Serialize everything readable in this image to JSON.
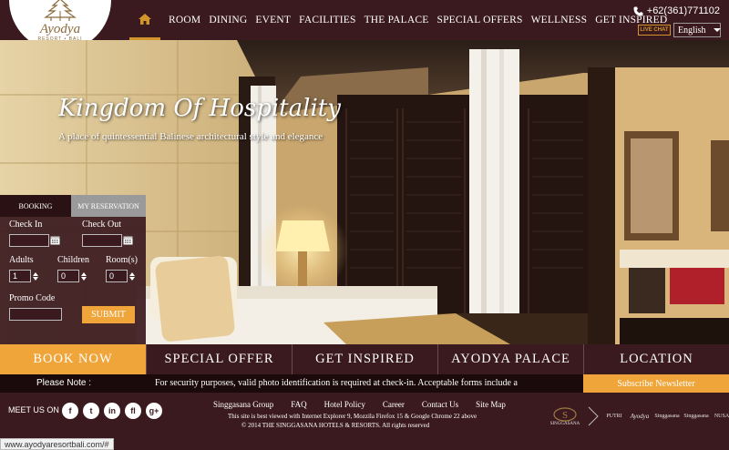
{
  "logo": {
    "name": "Ayodya",
    "sub": "RESORT • BALI"
  },
  "nav": {
    "home_icon": "home-icon",
    "items": [
      "ROOM",
      "DINING",
      "EVENT",
      "FACILITIES",
      "THE PALACE",
      "SPECIAL OFFERS",
      "WELLNESS",
      "GET INSPIRED"
    ]
  },
  "header": {
    "phone": "+62(361)771102",
    "live_chat": "LIVE CHAT",
    "language": "English"
  },
  "hero": {
    "headline": "Kingdom Of Hospitality",
    "tagline": "A place of quintessential Balinese architectural style and elegance"
  },
  "booking": {
    "tab_booking": "BOOKING",
    "tab_reservation": "MY RESERVATION",
    "check_in_label": "Check In",
    "check_out_label": "Check Out",
    "adults_label": "Adults",
    "children_label": "Children",
    "rooms_label": "Room(s)",
    "adults_value": "1",
    "children_value": "0",
    "rooms_value": "0",
    "promo_label": "Promo Code",
    "submit_label": "SUBMIT"
  },
  "bottombar": [
    "BOOK NOW",
    "SPECIAL OFFER",
    "GET INSPIRED",
    "AYODYA PALACE",
    "LOCATION"
  ],
  "note": {
    "label": "Please Note :",
    "text": "For security purposes, valid photo identification is required at check-in. Acceptable forms include a",
    "subscribe": "Subscribe Newsletter"
  },
  "footer": {
    "meet_label": "MEET US ON",
    "social": [
      "f",
      "t",
      "in",
      "fl",
      "g+"
    ],
    "links": [
      "Singgasana Group",
      "FAQ",
      "Hotel Policy",
      "Career",
      "Contact Us",
      "Site Map"
    ],
    "note1": "This site is best viewed with Internet Explorer 9, Mozzila Firefox 15 & Google Chrome 22 above",
    "note2": "© 2014 THE SINGGASANA HOTELS & RESORTS. All rights reserved",
    "brands": [
      "SINGGASANA",
      "PUTRI",
      "Ayodya",
      "Singgasana",
      "Singgasana",
      "NUSA"
    ]
  },
  "status_url": "www.ayodyaresortbali.com/#",
  "colors": {
    "brand_maroon": "#3a1a1f",
    "accent_orange": "#f0a53a",
    "gold": "#d2952b"
  }
}
